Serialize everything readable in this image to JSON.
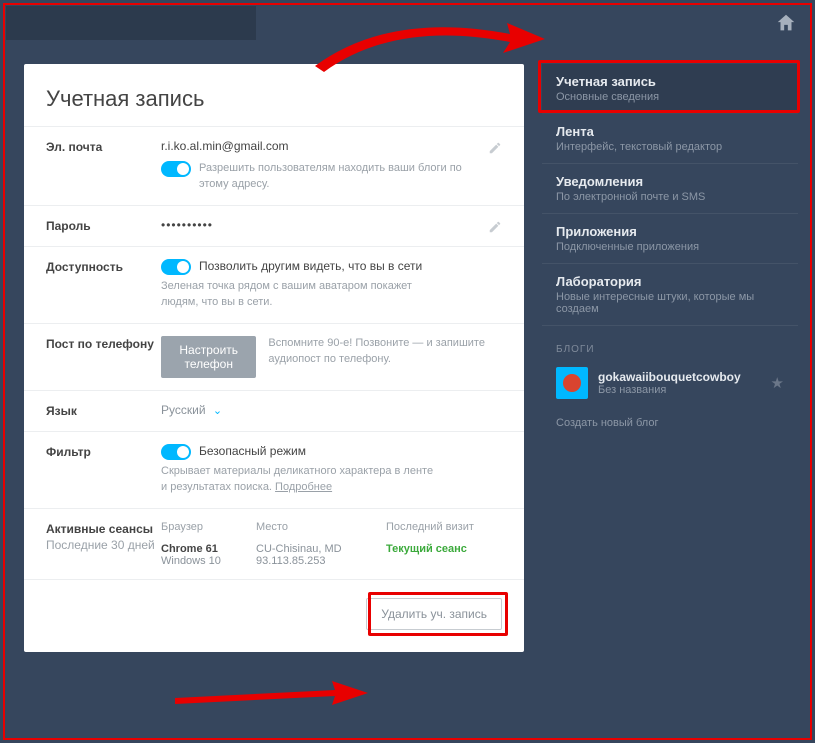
{
  "header": {
    "title": "Учетная запись"
  },
  "email": {
    "label": "Эл. почта",
    "value": "r.i.ko.al.min@gmail.com",
    "toggle_text": "Разрешить пользователям находить ваши блоги по этому адресу."
  },
  "password": {
    "label": "Пароль",
    "value": "••••••••••"
  },
  "availability": {
    "label": "Доступность",
    "toggle_text": "Позволить другим видеть, что вы в сети",
    "helper": "Зеленая точка рядом с вашим аватаром покажет людям, что вы в сети."
  },
  "phone_post": {
    "label": "Пост по телефону",
    "button": "Настроить телефон",
    "helper": "Вспомните 90-е! Позвоните — и запишите аудиопост по телефону."
  },
  "language": {
    "label": "Язык",
    "value": "Русский"
  },
  "filter": {
    "label": "Фильтр",
    "toggle_text": "Безопасный режим",
    "helper_pre": "Скрывает материалы деликатного характера в ленте и результатах поиска. ",
    "helper_link": "Подробнее"
  },
  "sessions": {
    "label": "Активные сеансы",
    "sublabel": "Последние 30 дней",
    "cols": {
      "browser": "Браузер",
      "place": "Место",
      "last": "Последний визит"
    },
    "row": {
      "browser": "Chrome 61",
      "os": "Windows 10",
      "place": "CU-Chisinau, MD",
      "ip": "93.113.85.253",
      "last": "Текущий сеанс"
    }
  },
  "delete_btn": "Удалить уч. запись",
  "nav": [
    {
      "title": "Учетная запись",
      "sub": "Основные сведения"
    },
    {
      "title": "Лента",
      "sub": "Интерфейс, текстовый редактор"
    },
    {
      "title": "Уведомления",
      "sub": "По электронной почте и SMS"
    },
    {
      "title": "Приложения",
      "sub": "Подключенные приложения"
    },
    {
      "title": "Лаборатория",
      "sub": "Новые интересные штуки, которые мы создаем"
    }
  ],
  "blogs_label": "БЛОГИ",
  "blog": {
    "name": "gokawaiibouquetcowboy",
    "sub": "Без названия"
  },
  "new_blog": "Создать новый блог"
}
